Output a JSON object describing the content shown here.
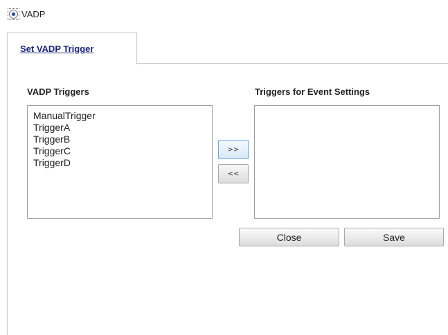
{
  "radio": {
    "label": "VADP",
    "checked": true
  },
  "tab": {
    "label": "Set VADP Trigger"
  },
  "left_list": {
    "heading": "VADP Triggers",
    "items": [
      "ManualTrigger",
      "TriggerA",
      "TriggerB",
      "TriggerC",
      "TriggerD"
    ]
  },
  "right_list": {
    "heading": "Triggers for Event Settings",
    "items": []
  },
  "buttons": {
    "add": ">>",
    "remove": "<<",
    "close": "Close",
    "save": "Save"
  },
  "colors": {
    "tab_link": "#1a237e",
    "radio_dot": "#1f4fa3",
    "border": "#a0a0a0"
  }
}
